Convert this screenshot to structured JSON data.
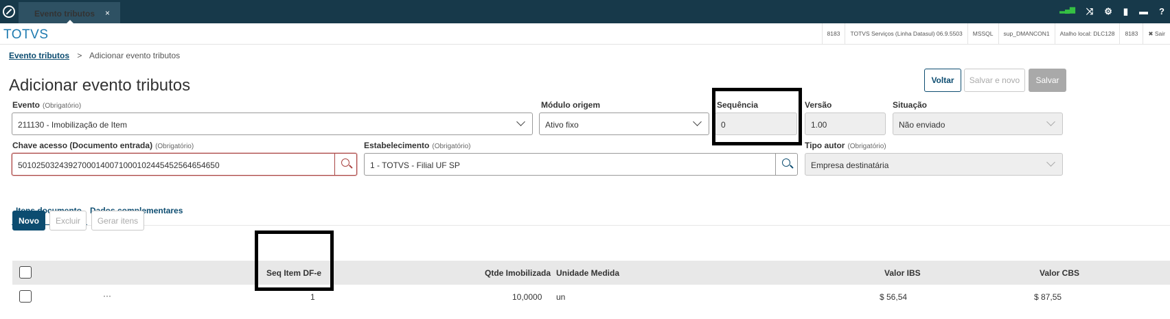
{
  "topbar": {
    "tab_label": "Evento tributos",
    "tab_close": "×"
  },
  "brand": "TOTVS",
  "infobar": [
    "8183",
    "TOTVS Serviços (Linha Datasul) 06.9.5503",
    "MSSQL",
    "sup_DMANCON1",
    "Atalho local: DLC128",
    "8183",
    "✖ Sair"
  ],
  "breadcrumb": {
    "root": "Evento tributos",
    "sep": ">",
    "current": "Adicionar evento tributos"
  },
  "title": "Adicionar evento tributos",
  "actions": {
    "voltar": "Voltar",
    "salvar_novo": "Salvar e novo",
    "salvar": "Salvar"
  },
  "form": {
    "evento": {
      "label": "Evento",
      "hint": "(Obrigatório)",
      "value": "211130 - Imobilização de Item"
    },
    "modulo": {
      "label": "Módulo origem",
      "value": "Ativo fixo"
    },
    "sequencia": {
      "label": "Sequência",
      "value": "0"
    },
    "versao": {
      "label": "Versão",
      "value": "1.00"
    },
    "situacao": {
      "label": "Situação",
      "value": "Não enviado"
    },
    "chave": {
      "label": "Chave acesso (Documento entrada)",
      "hint": "(Obrigatório)",
      "value": "50102503243927000140071000102445452564654650"
    },
    "estab": {
      "label": "Estabelecimento",
      "hint": "(Obrigatório)",
      "value": "1 - TOTVS - Filial UF SP"
    },
    "autor": {
      "label": "Tipo autor",
      "hint": "(Obrigatório)",
      "value": "Empresa destinatária"
    }
  },
  "tabs": [
    "Itens documento",
    "Dados complementares"
  ],
  "table_actions": {
    "novo": "Novo",
    "excluir": "Excluir",
    "gerar": "Gerar itens"
  },
  "table": {
    "headers": {
      "seq": "Seq Item DF-e",
      "qtde": "Qtde Imobilizada",
      "unidade": "Unidade Medida",
      "ibs": "Valor IBS",
      "cbs": "Valor CBS"
    },
    "rows": [
      {
        "more": "···",
        "seq": "1",
        "qtde": "10,0000",
        "unidade": "un",
        "ibs": "$ 56,54",
        "cbs": "$ 87,55"
      }
    ]
  }
}
